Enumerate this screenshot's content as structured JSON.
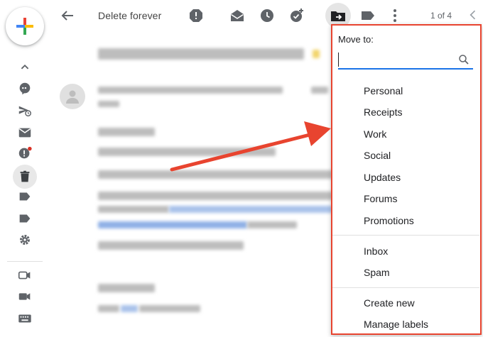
{
  "toolbar": {
    "delete_forever": "Delete forever",
    "pager": "1 of 4"
  },
  "move_menu": {
    "title": "Move to:",
    "search_value": "",
    "items": [
      "Personal",
      "Receipts",
      "Work",
      "Social",
      "Updates",
      "Forums",
      "Promotions"
    ],
    "system_items": [
      "Inbox",
      "Spam"
    ],
    "actions": [
      "Create new",
      "Manage labels"
    ]
  },
  "colors": {
    "annotation_red": "#e8442f",
    "focus_blue": "#1a73e8",
    "icon_gray": "#5f6368"
  },
  "icons": {
    "compose": "compose-plus-icon",
    "back": "arrow-back-icon",
    "report_spam": "report-icon",
    "mark_unread": "mark-unread-icon",
    "snooze": "clock-icon",
    "add_task": "add-task-icon",
    "move_to": "move-to-folder-icon",
    "labels": "label-icon",
    "more": "more-vert-icon",
    "prev": "chevron-left-icon",
    "search": "search-icon"
  }
}
